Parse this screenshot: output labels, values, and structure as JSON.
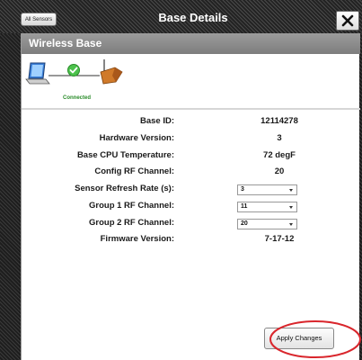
{
  "window": {
    "title": "Base Details",
    "all_sensors_label": "All Sensors"
  },
  "dialog": {
    "header": "Wireless Base",
    "status": "Connected"
  },
  "details": [
    {
      "label": "Base ID:",
      "value": "12114278"
    },
    {
      "label": "Hardware Version:",
      "value": "3"
    },
    {
      "label": "Base CPU Temperature:",
      "value": "72 degF"
    },
    {
      "label": "Config RF Channel:",
      "value": "20"
    },
    {
      "label": "Sensor Refresh Rate (s):",
      "selected": "3"
    },
    {
      "label": "Group 1 RF Channel:",
      "selected": "11"
    },
    {
      "label": "Group 2 RF Channel:",
      "selected": "20"
    },
    {
      "label": "Firmware Version:",
      "value": "7-17-12"
    }
  ],
  "apply_label": "Apply Changes",
  "icons": {
    "computer": "laptop-icon",
    "status": "check-circle-icon",
    "base": "wireless-base-icon",
    "close": "close-icon",
    "dropdown": "chevron-down-icon"
  },
  "colors": {
    "connected_green": "#2a8c2a",
    "check_green": "#4cc24c",
    "base_orange": "#d07a2a",
    "annotation_red": "#d9262c"
  }
}
